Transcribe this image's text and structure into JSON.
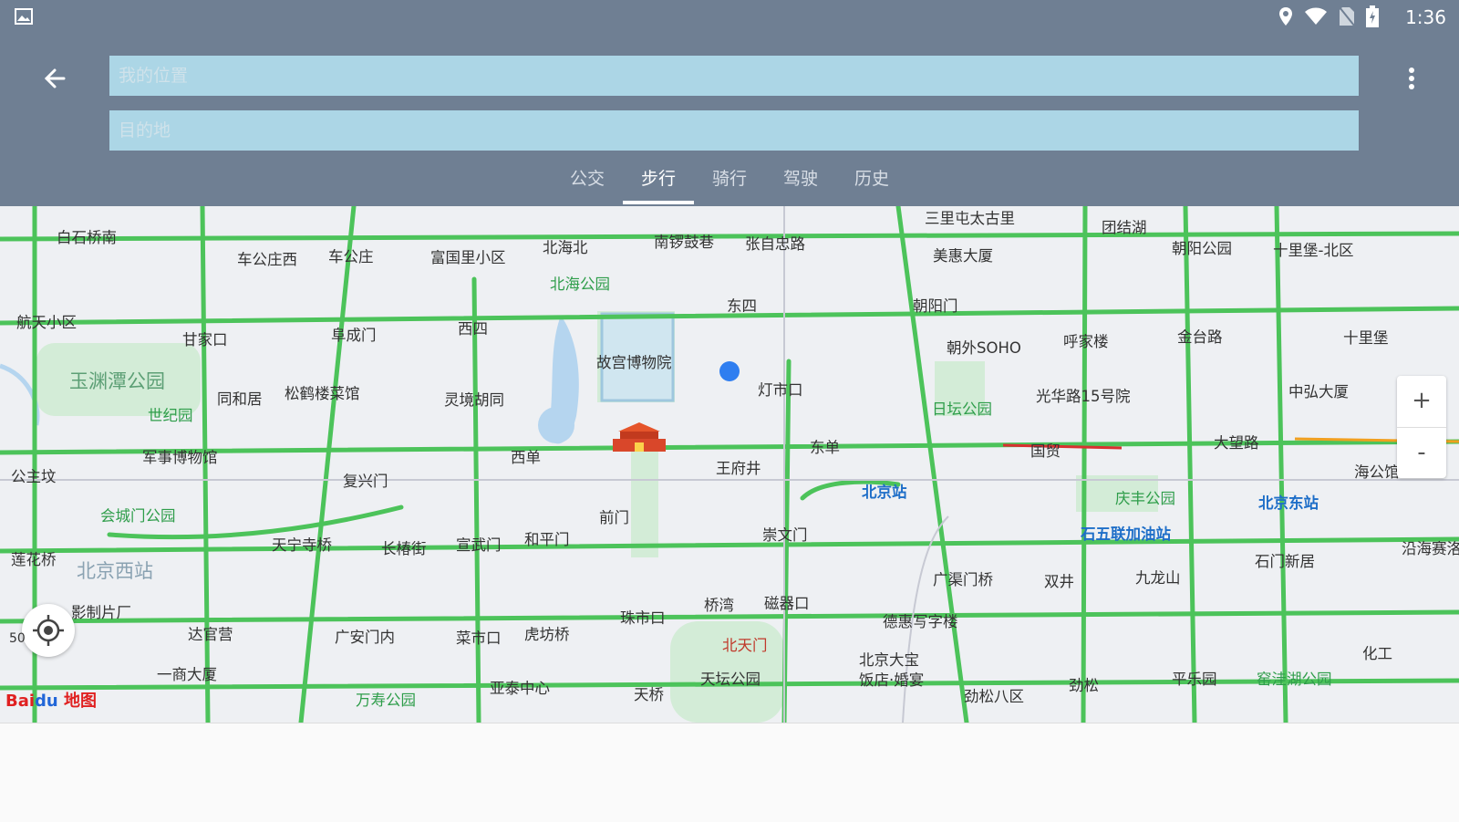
{
  "status": {
    "time": "1:36"
  },
  "search": {
    "start_placeholder": "我的位置",
    "dest_placeholder": "目的地"
  },
  "tabs": [
    {
      "label": "公交"
    },
    {
      "label": "步行"
    },
    {
      "label": "骑行"
    },
    {
      "label": "驾驶"
    },
    {
      "label": "历史"
    }
  ],
  "active_tab": "步行",
  "map": {
    "labels": {
      "baishiqiao": "白石桥南",
      "chegongzhuangxi": "车公庄西",
      "chegongzhuang": "车公庄",
      "fuguoli": "富国里小区",
      "beihaibei": "北海北",
      "nanluoguxiang": "南锣鼓巷",
      "zhangzizhong": "张自忠路",
      "sanlitun": "三里屯太古里",
      "tuanjiehu": "团结湖",
      "chaoyanggongyuan": "朝阳公园",
      "shilibao_bei": "十里堡-北区",
      "meihui": "美惠大厦",
      "beihaigongyuan": "北海公园",
      "hangtian": "航天小区",
      "ganjiakou": "甘家口",
      "fuchengmen": "阜成门",
      "xisi": "西四",
      "dongsi": "东四",
      "chaoyangmen": "朝阳门",
      "chaowai_soho": "朝外SOHO",
      "hujialou": "呼家楼",
      "jintailu": "金台路",
      "shilibao": "十里堡",
      "gugong": "故宫博物院",
      "yuyuantan": "玉渊潭公园",
      "tongheju": "同和居",
      "songhelou": "松鹤楼菜馆",
      "lingjing": "灵境胡同",
      "dengshikou": "灯市口",
      "ritan": "日坛公园",
      "guanghua15": "光华路15号院",
      "zhonghong": "中弘大厦",
      "shijiyuan": "世纪园",
      "gongzhufen": "公主坟",
      "junshi": "军事博物馆",
      "fuxingmen": "复兴门",
      "xidan": "西单",
      "wangfujing": "王府井",
      "dongdan": "东单",
      "guomao": "国贸",
      "dawanglu": "大望路",
      "haiyangguan": "海公馆",
      "beijingzhan": "北京站",
      "qingfeng": "庆丰公园",
      "beijingdong": "北京东站",
      "huichengmen": "会城门公园",
      "tianningsi": "天宁寺桥",
      "changchunjie": "长椿街",
      "xuanwumen": "宣武门",
      "hepingmen": "和平门",
      "qianmen": "前门",
      "chongwenmen": "崇文门",
      "shiwulian": "石五联加油站",
      "lianhuaqiao": "莲花桥",
      "beijingxi": "北京西站",
      "guangqumenqiao": "广渠门桥",
      "shuangjing": "双井",
      "jiulongshan": "九龙山",
      "shimenxinju": "石门新居",
      "yanhai": "沿海赛洛",
      "dianying": "影制片厂",
      "daguanying": "达官营",
      "guanganmennei": "广安门内",
      "caishikou": "菜市口",
      "hufangqiao": "虎坊桥",
      "zhushikou": "珠市口",
      "qiaowan": "桥湾",
      "ciqikou": "磁器口",
      "dehui": "德惠写字楼",
      "beitianmen": "北天门",
      "huagong": "化工",
      "yishang": "一商大厦",
      "yatai": "亚泰中心",
      "tianqiao": "天桥",
      "tiantan": "天坛公园",
      "beijingdabao": "北京大宝",
      "fandian": "饭店·婚宴",
      "jinsong": "劲松",
      "pingleyuan": "平乐园",
      "yaowahu": "窑洼湖公园",
      "wanshou": "万寿公园",
      "jinsongba": "劲松八区"
    },
    "zoom_in": "+",
    "zoom_out": "-",
    "scale": "50"
  },
  "colors": {
    "header": "#6f7f93",
    "field": "#acd6e6",
    "road": "#4cc35a",
    "metro": "#1e6ec8"
  }
}
